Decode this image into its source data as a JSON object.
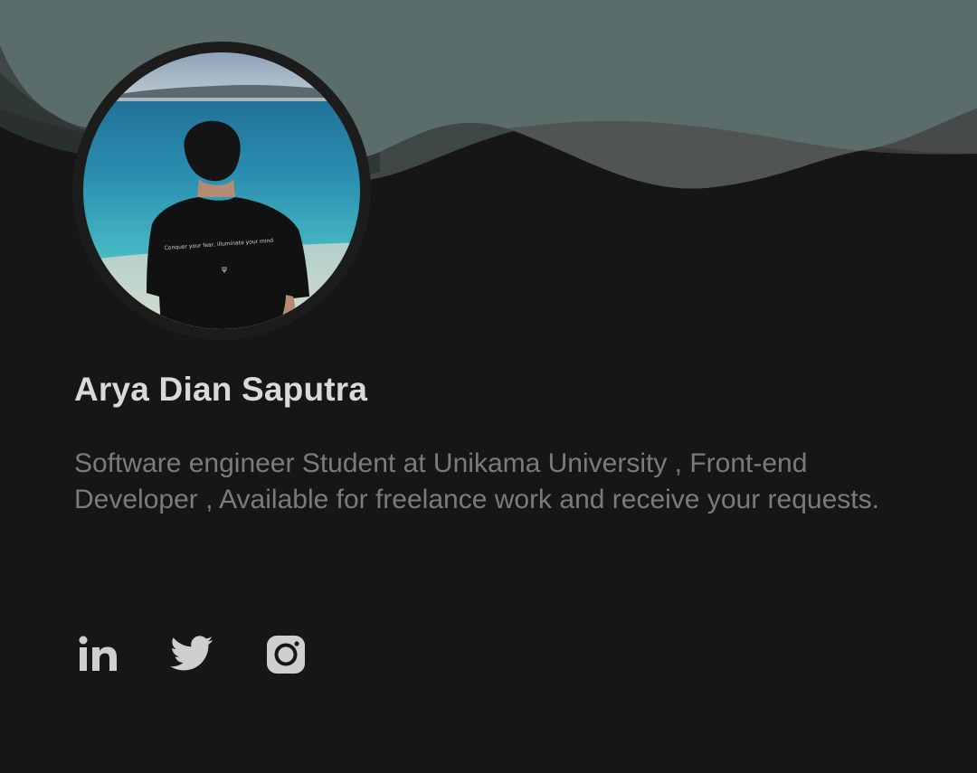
{
  "profile": {
    "name": "Arya Dian Saputra",
    "bio": "Software engineer Student at Unikama University , Front-end Developer , Available for freelance work and receive your requests."
  },
  "social_links": [
    {
      "name": "linkedin",
      "icon": "linkedin-icon"
    },
    {
      "name": "twitter",
      "icon": "twitter-icon"
    },
    {
      "name": "instagram",
      "icon": "instagram-icon"
    }
  ],
  "colors": {
    "background": "#161616",
    "wave_light": "#5a6d6a",
    "wave_dark": "#3e4646",
    "text_primary": "#d9d9d9",
    "text_secondary": "#7b7b7b",
    "icon": "#cfcfcf"
  }
}
